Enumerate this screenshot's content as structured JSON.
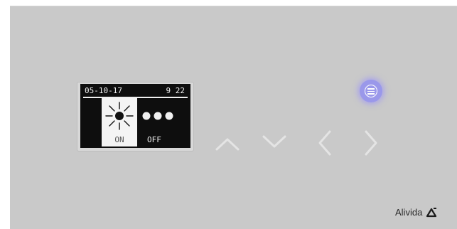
{
  "lcd": {
    "date": "05-10-17",
    "time": "9 22",
    "modes": [
      {
        "label": "ON",
        "icon": "sun-icon",
        "selected": true
      },
      {
        "label": "OFF",
        "icon": "dots-icon",
        "selected": false
      }
    ]
  },
  "controls": {
    "menu": {
      "icon": "menu-icon",
      "glow_color": "#9a98ea"
    },
    "nav": [
      "chevron-up-icon",
      "chevron-down-icon",
      "chevron-left-icon",
      "chevron-right-icon"
    ]
  },
  "brand": {
    "name": "Alivida",
    "logo_icon": "alivida-logo-icon"
  },
  "colors": {
    "panel": "#c9c9c9",
    "lcd_background": "#0e0e0e",
    "menu_accent": "#9a98ea"
  }
}
